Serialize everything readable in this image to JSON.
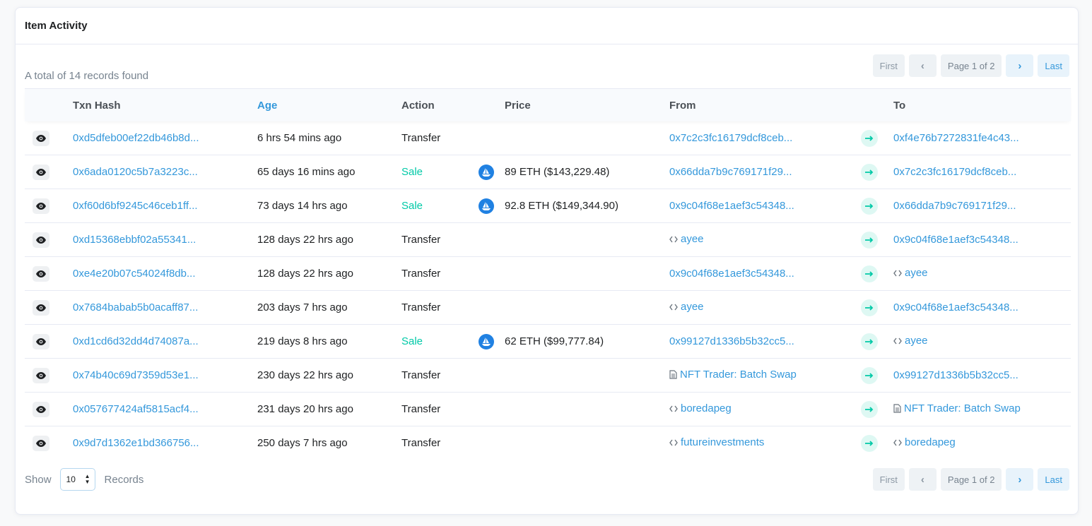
{
  "card": {
    "title": "Item Activity"
  },
  "summary": {
    "total_text": "A total of 14 records found"
  },
  "pagination": {
    "first": "First",
    "prev": "‹",
    "page_info": "Page 1 of 2",
    "next": "›",
    "last": "Last"
  },
  "table": {
    "columns": {
      "txn_hash": "Txn Hash",
      "age": "Age",
      "action": "Action",
      "price": "Price",
      "from": "From",
      "to": "To"
    },
    "rows": [
      {
        "hash": "0xd5dfeb00ef22db46b8d...",
        "age": "6 hrs 54 mins ago",
        "action": "Transfer",
        "sale": false,
        "price": "",
        "from": "0x7c2c3fc16179dcf8ceb...",
        "from_icon": "",
        "to": "0xf4e76b7272831fe4c43...",
        "to_icon": ""
      },
      {
        "hash": "0x6ada0120c5b7a3223c...",
        "age": "65 days 16 mins ago",
        "action": "Sale",
        "sale": true,
        "price": "89 ETH ($143,229.48)",
        "from": "0x66dda7b9c769171f29...",
        "from_icon": "",
        "to": "0x7c2c3fc16179dcf8ceb...",
        "to_icon": ""
      },
      {
        "hash": "0xf60d6bf9245c46ceb1ff...",
        "age": "73 days 14 hrs ago",
        "action": "Sale",
        "sale": true,
        "price": "92.8 ETH ($149,344.90)",
        "from": "0x9c04f68e1aef3c54348...",
        "from_icon": "",
        "to": "0x66dda7b9c769171f29...",
        "to_icon": ""
      },
      {
        "hash": "0xd15368ebbf02a55341...",
        "age": "128 days 22 hrs ago",
        "action": "Transfer",
        "sale": false,
        "price": "",
        "from": "ayee",
        "from_icon": "code",
        "to": "0x9c04f68e1aef3c54348...",
        "to_icon": ""
      },
      {
        "hash": "0xe4e20b07c54024f8db...",
        "age": "128 days 22 hrs ago",
        "action": "Transfer",
        "sale": false,
        "price": "",
        "from": "0x9c04f68e1aef3c54348...",
        "from_icon": "",
        "to": "ayee",
        "to_icon": "code"
      },
      {
        "hash": "0x7684babab5b0acaff87...",
        "age": "203 days 7 hrs ago",
        "action": "Transfer",
        "sale": false,
        "price": "",
        "from": "ayee",
        "from_icon": "code",
        "to": "0x9c04f68e1aef3c54348...",
        "to_icon": ""
      },
      {
        "hash": "0xd1cd6d32dd4d74087a...",
        "age": "219 days 8 hrs ago",
        "action": "Sale",
        "sale": true,
        "price": "62 ETH ($99,777.84)",
        "from": "0x99127d1336b5b32cc5...",
        "from_icon": "",
        "to": "ayee",
        "to_icon": "code"
      },
      {
        "hash": "0x74b40c69d7359d53e1...",
        "age": "230 days 22 hrs ago",
        "action": "Transfer",
        "sale": false,
        "price": "",
        "from": "NFT Trader: Batch Swap",
        "from_icon": "file",
        "to": "0x99127d1336b5b32cc5...",
        "to_icon": ""
      },
      {
        "hash": "0x057677424af5815acf4...",
        "age": "231 days 20 hrs ago",
        "action": "Transfer",
        "sale": false,
        "price": "",
        "from": "boredapeg",
        "from_icon": "code",
        "to": "NFT Trader: Batch Swap",
        "to_icon": "file"
      },
      {
        "hash": "0x9d7d1362e1bd366756...",
        "age": "250 days 7 hrs ago",
        "action": "Transfer",
        "sale": false,
        "price": "",
        "from": "futureinvestments",
        "from_icon": "code",
        "to": "boredapeg",
        "to_icon": "code"
      }
    ]
  },
  "footer": {
    "show_label": "Show",
    "records_label": "Records",
    "page_size": "10"
  },
  "colors": {
    "link": "#3498db",
    "sale": "#00c9a7",
    "opensea": "#2081e2"
  }
}
